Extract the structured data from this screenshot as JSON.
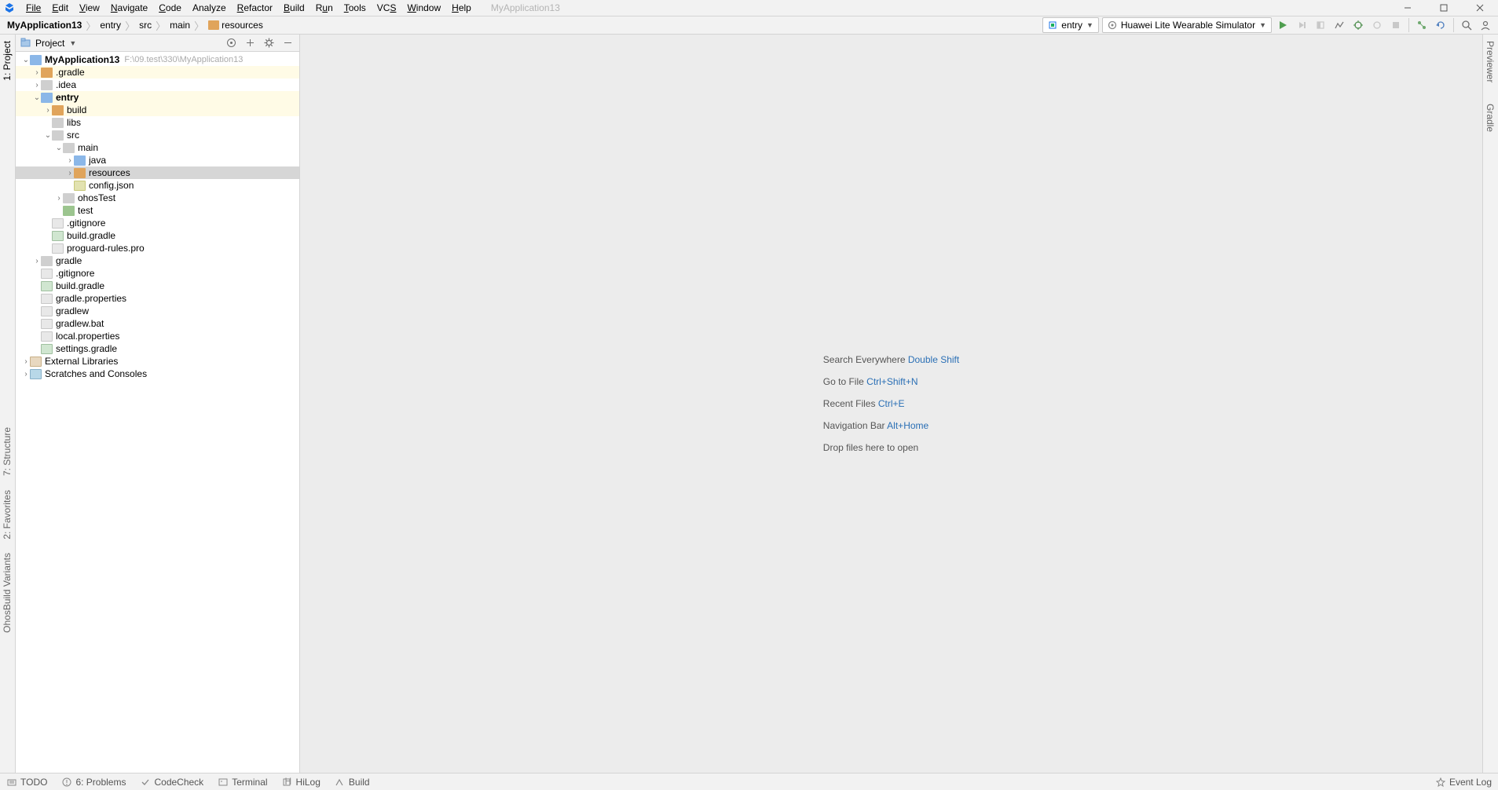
{
  "app": {
    "title_hint": "MyApplication13"
  },
  "menu": {
    "file": "File",
    "edit": "Edit",
    "view": "View",
    "navigate": "Navigate",
    "code": "Code",
    "analyze": "Analyze",
    "refactor": "Refactor",
    "build": "Build",
    "run": "Run",
    "tools": "Tools",
    "vcs": "VCS",
    "window": "Window",
    "help": "Help"
  },
  "breadcrumbs": {
    "items": [
      {
        "label": "MyApplication13",
        "bold": true
      },
      {
        "label": "entry"
      },
      {
        "label": "src"
      },
      {
        "label": "main"
      },
      {
        "label": "resources",
        "icon": "orange"
      }
    ]
  },
  "run": {
    "config": "entry",
    "device": "Huawei Lite Wearable Simulator"
  },
  "project_panel": {
    "title": "Project"
  },
  "tree": [
    {
      "d": 0,
      "arrow": "down",
      "icon": "iconFolderBlue",
      "label": "MyApplication13",
      "bold": true,
      "path": "F:\\09.test\\330\\MyApplication13"
    },
    {
      "d": 1,
      "arrow": "right",
      "icon": "iconFolderOrange",
      "label": ".gradle",
      "hi": true
    },
    {
      "d": 1,
      "arrow": "right",
      "icon": "iconFolder",
      "label": ".idea"
    },
    {
      "d": 1,
      "arrow": "down",
      "icon": "iconFolderBlue",
      "label": "entry",
      "bold": true,
      "hi": true
    },
    {
      "d": 2,
      "arrow": "right",
      "icon": "iconFolderOrange",
      "label": "build",
      "hi": true
    },
    {
      "d": 2,
      "arrow": "none",
      "icon": "iconFolder",
      "label": "libs"
    },
    {
      "d": 2,
      "arrow": "down",
      "icon": "iconFolder",
      "label": "src"
    },
    {
      "d": 3,
      "arrow": "down",
      "icon": "iconFolder",
      "label": "main"
    },
    {
      "d": 4,
      "arrow": "right",
      "icon": "iconFolderBlue",
      "label": "java"
    },
    {
      "d": 4,
      "arrow": "right",
      "icon": "iconFolderOrange",
      "label": "resources",
      "sel": true
    },
    {
      "d": 4,
      "arrow": "none",
      "icon": "iconJson",
      "label": "config.json"
    },
    {
      "d": 3,
      "arrow": "right",
      "icon": "iconFolder",
      "label": "ohosTest"
    },
    {
      "d": 3,
      "arrow": "none",
      "icon": "iconFolderGreen",
      "label": "test"
    },
    {
      "d": 2,
      "arrow": "none",
      "icon": "iconFile",
      "label": ".gitignore"
    },
    {
      "d": 2,
      "arrow": "none",
      "icon": "iconGradle",
      "label": "build.gradle"
    },
    {
      "d": 2,
      "arrow": "none",
      "icon": "iconFile",
      "label": "proguard-rules.pro"
    },
    {
      "d": 1,
      "arrow": "right",
      "icon": "iconFolder",
      "label": "gradle"
    },
    {
      "d": 1,
      "arrow": "none",
      "icon": "iconFile",
      "label": ".gitignore"
    },
    {
      "d": 1,
      "arrow": "none",
      "icon": "iconGradle",
      "label": "build.gradle"
    },
    {
      "d": 1,
      "arrow": "none",
      "icon": "iconFile",
      "label": "gradle.properties"
    },
    {
      "d": 1,
      "arrow": "none",
      "icon": "iconFile",
      "label": "gradlew"
    },
    {
      "d": 1,
      "arrow": "none",
      "icon": "iconFile",
      "label": "gradlew.bat"
    },
    {
      "d": 1,
      "arrow": "none",
      "icon": "iconFile",
      "label": "local.properties"
    },
    {
      "d": 1,
      "arrow": "none",
      "icon": "iconGradle",
      "label": "settings.gradle"
    },
    {
      "d": 0,
      "arrow": "right",
      "icon": "iconLib",
      "label": "External Libraries"
    },
    {
      "d": 0,
      "arrow": "right",
      "icon": "iconScratch",
      "label": "Scratches and Consoles"
    }
  ],
  "tips": [
    {
      "text": "Search Everywhere",
      "key": "Double Shift"
    },
    {
      "text": "Go to File",
      "key": "Ctrl+Shift+N"
    },
    {
      "text": "Recent Files",
      "key": "Ctrl+E"
    },
    {
      "text": "Navigation Bar",
      "key": "Alt+Home"
    },
    {
      "text": "Drop files here to open",
      "key": ""
    }
  ],
  "status": {
    "items": [
      "TODO",
      "6: Problems",
      "CodeCheck",
      "Terminal",
      "HiLog",
      "Build"
    ],
    "event_log": "Event Log"
  },
  "left_tabs": {
    "project": "1: Project",
    "structure": "7: Structure",
    "favorites": "2: Favorites",
    "variants": "OhosBuild Variants"
  },
  "right_tabs": {
    "previewer": "Previewer",
    "gradle": "Gradle"
  }
}
